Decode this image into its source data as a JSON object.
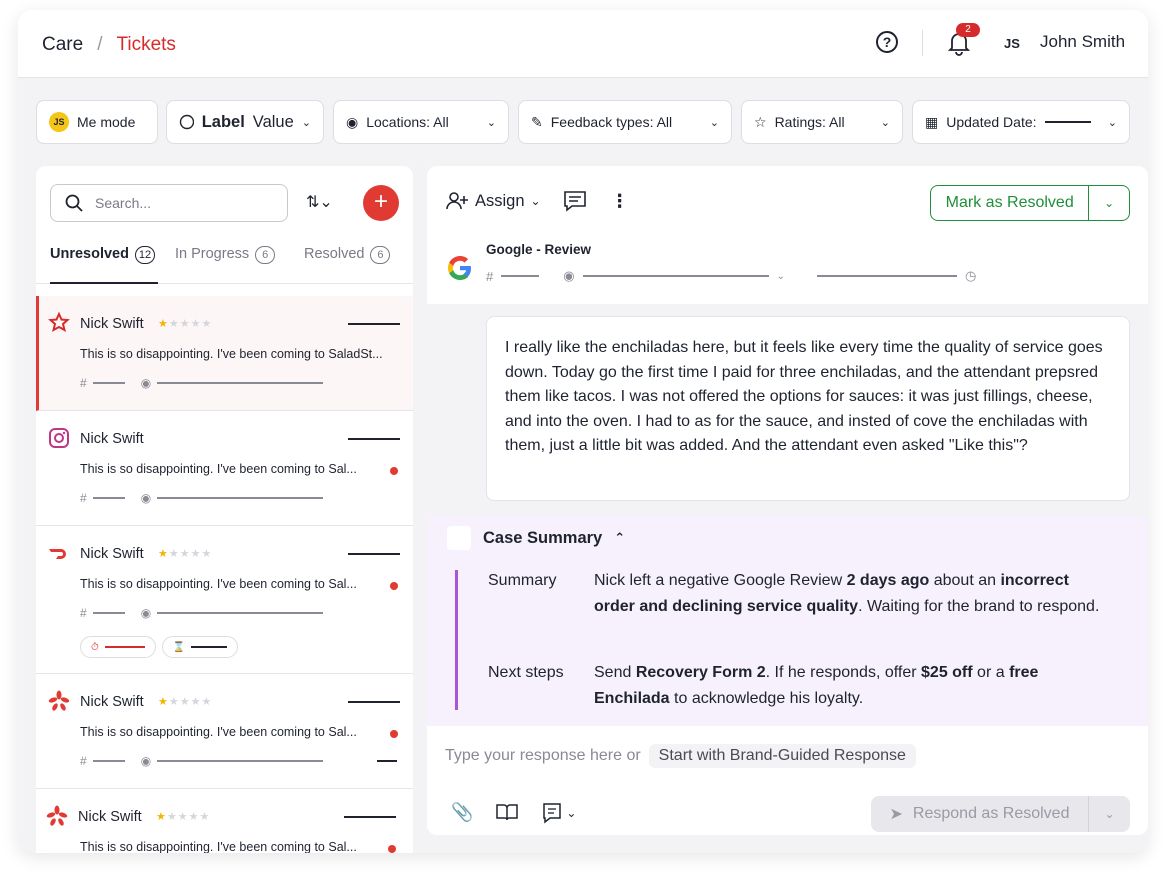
{
  "breadcrumb": {
    "root": "Care",
    "separator": "/",
    "current": "Tickets"
  },
  "header": {
    "notifications_count": "2",
    "user_initials": "JS",
    "user_name": "John Smith"
  },
  "filters": {
    "me_mode_initials": "JS",
    "me_mode": "Me mode",
    "label": "Label",
    "label_value": "Value",
    "locations": "Locations: All",
    "feedback_types": "Feedback types: All",
    "ratings": "Ratings: All",
    "updated_date": "Updated Date:"
  },
  "list": {
    "search_placeholder": "Search...",
    "tabs": [
      {
        "label": "Unresolved",
        "count": "12"
      },
      {
        "label": "In Progress",
        "count": "6"
      },
      {
        "label": "Resolved",
        "count": "6"
      }
    ],
    "tickets": [
      {
        "source": "yelp-icon",
        "name": "Nick Swift",
        "rating": 1,
        "text": "This is so disappointing. I've been coming to SaladSt...",
        "unread": false
      },
      {
        "source": "instagram-icon",
        "name": "Nick Swift",
        "rating": 0,
        "text": "This is so disappointing. I've been coming to Sal...",
        "unread": true
      },
      {
        "source": "doordash-icon",
        "name": "Nick Swift",
        "rating": 1,
        "text": "This is so disappointing. I've been coming to Sal...",
        "unread": true
      },
      {
        "source": "yelp-icon",
        "name": "Nick Swift",
        "rating": 1,
        "text": "This is so disappointing. I've been coming to Sal...",
        "unread": true
      },
      {
        "source": "yelp-icon",
        "name": "Nick Swift",
        "rating": 1,
        "text": "This is so disappointing. I've been coming to Sal...",
        "unread": true
      }
    ]
  },
  "detail": {
    "assign": "Assign",
    "resolve": "Mark as Resolved",
    "source_title": "Google - Review",
    "message": "I really like the enchiladas here, but it feels like every time the quality of service goes down. Today go the first time I paid for three enchiladas, and the attendant prepsred them like tacos. I was not offered the options for sauces: it was just fillings, cheese, and into the oven. I had to as for the sauce, and insted of cove the enchiladas with them, just a little bit was added. And the attendant even asked \"Like this\"?",
    "case_summary_title": "Case Summary",
    "summary_label": "Summary",
    "summary_p1": "Nick left a negative Google Review ",
    "summary_b1": "2 days ago",
    "summary_p2": " about an ",
    "summary_b2": "incorrect order and declining service quality",
    "summary_p3": ". Waiting for the brand to respond.",
    "next_label": "Next steps",
    "next_p1": "Send ",
    "next_b1": "Recovery Form 2",
    "next_p2": ". If he responds, offer ",
    "next_b2": "$25 off",
    "next_p3": " or a ",
    "next_b3": "free Enchilada",
    "next_p4": " to acknowledge his loyalty.",
    "reply_placeholder": "Type your response here or",
    "brand_guided": "Start with Brand-Guided Response",
    "respond": "Respond as Resolved"
  },
  "colors": {
    "accent": "#d62b2b",
    "resolve_green": "#1f8f3a",
    "summary_bg": "#f6f1fc",
    "summary_bar": "#a855d6"
  }
}
